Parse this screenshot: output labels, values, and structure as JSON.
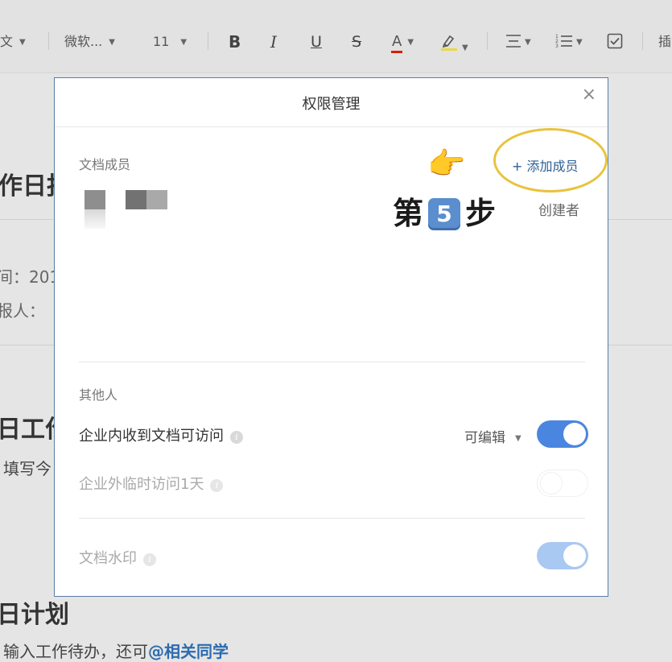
{
  "toolbar": {
    "style_label": "文",
    "font_name": "微软...",
    "font_size": "11",
    "bold": "B",
    "italic": "I",
    "underline": "U",
    "strike": "S",
    "font_color": "A",
    "insert_label": "插"
  },
  "background_doc": {
    "heading_1": "作日报",
    "date_line": "间：201",
    "reporter_line": "报人：",
    "heading_2": "日工作",
    "fill_line": "填写今",
    "heading_3": "日计划",
    "todo_line": "输入工作待办，还可",
    "mention": "@相关同学"
  },
  "dialog": {
    "title": "权限管理",
    "close": "×",
    "members_label": "文档成员",
    "add_member": "+ 添加成员",
    "creator_role": "创建者",
    "annotation_prefix": "第",
    "annotation_number": "5",
    "annotation_suffix": "步",
    "others_label": "其他人",
    "internal_access_label": "企业内收到文档可访问",
    "internal_permission": "可编辑",
    "external_access_label": "企业外临时访问1天",
    "watermark_label": "文档水印",
    "info_glyph": "i",
    "pointer_glyph": "👉"
  },
  "toggles": {
    "internal_access": true,
    "external_access": false,
    "watermark": true
  },
  "colors": {
    "accent": "#4a86e0",
    "link": "#2c5f93",
    "highlight_circle": "#e8c33d",
    "mention": "#2b6cb0"
  }
}
